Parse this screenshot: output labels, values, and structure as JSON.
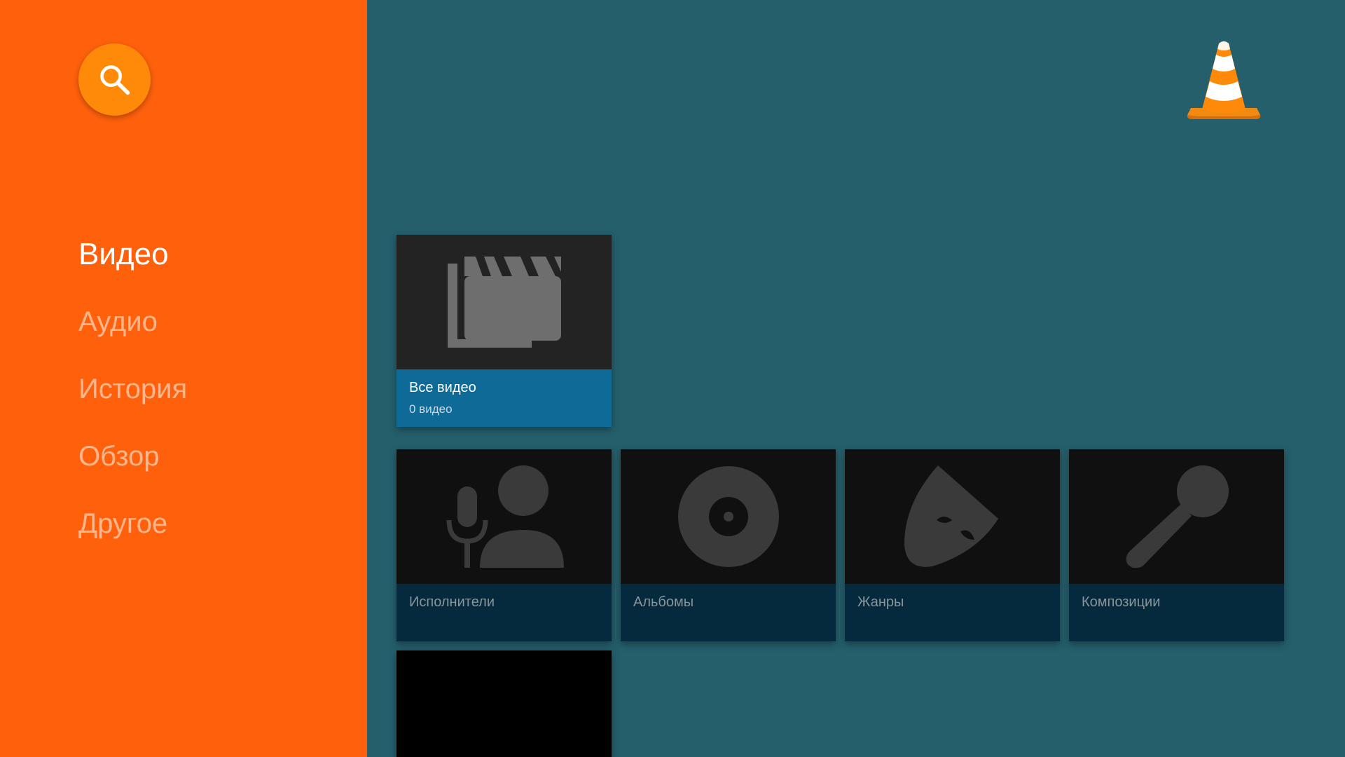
{
  "sidebar": {
    "search_icon": "search-icon",
    "items": [
      {
        "label": "Видео",
        "active": true
      },
      {
        "label": "Аудио",
        "active": false
      },
      {
        "label": "История",
        "active": false
      },
      {
        "label": "Обзор",
        "active": false
      },
      {
        "label": "Другое",
        "active": false
      }
    ]
  },
  "header": {
    "logo_icon": "vlc-cone-icon"
  },
  "video_row": {
    "cards": [
      {
        "title": "Все видео",
        "subtitle": "0 видео",
        "icon": "movie-clapper-icon"
      }
    ]
  },
  "audio_row": {
    "cards": [
      {
        "title": "Исполнители",
        "icon": "artist-microphone-icon"
      },
      {
        "title": "Альбомы",
        "icon": "album-disc-icon"
      },
      {
        "title": "Жанры",
        "icon": "genre-mask-icon"
      },
      {
        "title": "Композиции",
        "icon": "song-microphone-icon"
      }
    ]
  },
  "colors": {
    "sidebar": "#FF600C",
    "background": "#245F6B",
    "search_button": "#FF8A0A",
    "featured_info": "#0E6A96",
    "card_info": "#052A3D"
  }
}
